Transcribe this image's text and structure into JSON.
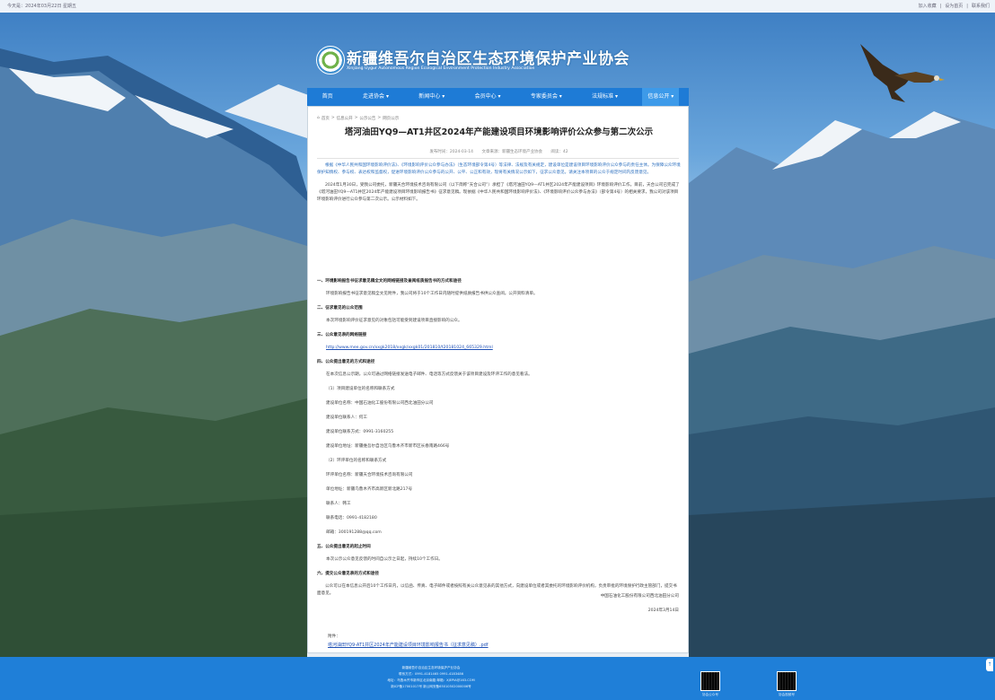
{
  "topbar": {
    "left": "今天是：2024年03月22日 星期五",
    "links": [
      "加入收藏",
      "设为首页",
      "联系我们"
    ]
  },
  "header": {
    "site_name": "新疆维吾尔自治区生态环境保护产业协会",
    "site_name_en": "Xinjiang Uygur Autonomous Region Ecological Environment Protection Industry Association"
  },
  "nav": {
    "items": [
      {
        "label": "首页"
      },
      {
        "label": "走进协会 ▾"
      },
      {
        "label": "新闻中心 ▾"
      },
      {
        "label": "会员中心 ▾"
      },
      {
        "label": "专家委员会 ▾"
      },
      {
        "label": "法规标准 ▾"
      },
      {
        "label": "信息公开 ▾"
      }
    ]
  },
  "breadcrumb": {
    "home": "首页",
    "sep": ">",
    "level1": "信息公开",
    "level2": "公示公告",
    "level3": "网页公示"
  },
  "article": {
    "title": "塔河油田YQ9—AT1井区2024年产能建设项目环境影响评价公众参与第二次公示",
    "meta": {
      "date": "发布时间：2024-03-14",
      "source": "文章来源：新疆生态环境产业协会",
      "views": "阅读：42"
    },
    "intro": "根据《中华人民共和国环境影响评价法》、《环境影响评价公众参与办法》（生态环境部令第4号）等法律、法规及有关规定，建设单位是建设项目环境影响评价公众参与的责任主体。为保障公众环境保护知情权、参与权、表达权和监督权，促进环境影响评价公众参与的公开、公平、公正和有效，现将有关情况公示如下，征求公众意见。请关注本项目的公众于规定时间内反馈意见。",
    "para1": "2024年1月30日，受我公司委托，新疆天合环境技术咨询有限公司（以下简称“天合公司”）承担了《塔河油田YQ9—AT1井区2024年产能建设项目》环境影响评价工作。目前，天合公司已完成了《塔河油田YQ9—AT1井区2024年产能建设项目环境影响报告书》征求意见稿。现依据《中华人民共和国环境影响评价法》、《环境影响评价公众参与办法》（部令第4号）的相关要求，我公司对该项目环境影响评价进行公众参与第二次公示。公示材料如下。",
    "s1_title": "一、环境影响报告书征求意见稿全文的网络链接及查阅纸质报告书的方式和途径",
    "s1_text": "环境影响报告书征求意见稿全文见附件，我公司将于10个工作日内随时提供纸质报告书供公众查阅。公开资料清单。",
    "s2_title": "二、征求意见的公众范围",
    "s2_text": "本次环境影响评价征求意见的对象包括可能受到建设项目直接影响的公众。",
    "s3_title": "三、公众意见表的网络链接",
    "s3_link": "http://www.mee.gov.cn/xxgk2018/xxgk/xxgk01/201810/t20181024_665329.html",
    "s4_title": "四、公众提出意见的方式和途径",
    "s4_text": "在本次信息公示期，公众可通过网络链接发送电子邮件、电话等方式反馈关于该项目建设及环评工作的意见看法。",
    "c1": "（1）项目建设单位的名称和联系方式",
    "c1_name": "建设单位名称：中国石油化工股份有限公司西北油田分公司",
    "c1_contact": "建设单位联系人：何工",
    "c1_phone": "建设单位联系方式：0991-3160255",
    "c1_addr": "建设单位地址：新疆维吾尔自治区乌鲁木齐市新市区长春南路466号",
    "c2": "（2）环评单位的名称和联系方式",
    "c2_name": "环评单位名称：新疆天合环境技术咨询有限公司",
    "c2_addr": "单位地址：新疆乌鲁木齐市高新区新北路217号",
    "c2_contact": "联系人：韩工",
    "c2_phone": "联系电话：0991-4182180",
    "c2_email": "邮箱：300191288@qq.com",
    "s5_title": "五、公众提出意见的起止时间",
    "s5_text": "本次公示公众意见反馈的时间自公示之日起，持续10个工作日。",
    "s6_title": "六、提交公众意见表的方式和途径",
    "s6_text": "公众可以在本信息公开后10个工作日内，以信函、传真、电子邮件或者按照有关公众意见表的其他方式，向建设单位或者其委托的环境影响评价机构，负责审批的环境保护行政主管部门，提交书面意见。",
    "sign_org": "中国石油化工股份有限公司西北油田分公司",
    "sign_date": "2024年3月14日",
    "attach_label": "附件：",
    "attach_file": "塔河油田YQ9-AT1井区2024年产能建设项目环境影响报告书（征求意见稿）.pdf"
  },
  "footer": {
    "lines": [
      "新疆维吾尔自治区生态环境保护产业协会",
      "联系方式：0991-4181465 0991-4183486",
      "地址：乌鲁木齐市新市区北京南路 邮箱：XJEPIA@163.COM",
      "新ICP备17001017号 新公网安备65010502000006号"
    ],
    "qr1_label": "协会公众号",
    "qr2_label": "协会视频号"
  },
  "colors": {
    "nav": "#1e7bd6",
    "footer": "#1f7fd8",
    "title": "#222222",
    "link": "#1d4fb5"
  }
}
